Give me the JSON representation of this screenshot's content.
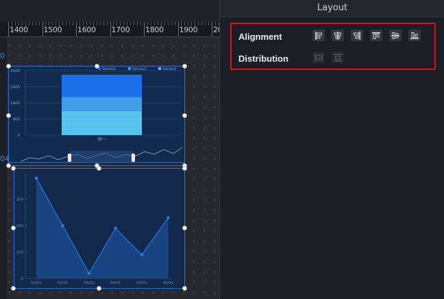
{
  "panel": {
    "title": "Layout"
  },
  "alignment": {
    "label": "Alignment",
    "tools": [
      "align-left-icon",
      "align-center-horizontal-icon",
      "align-right-icon",
      "align-top-icon",
      "align-center-vertical-icon",
      "align-bottom-icon"
    ]
  },
  "distribution": {
    "label": "Distribution",
    "tools": [
      "distribute-horizontal-icon",
      "distribute-vertical-icon"
    ]
  },
  "ruler": {
    "labels": [
      "1400",
      "1500",
      "1600",
      "1700",
      "1800",
      "1900",
      "20"
    ]
  },
  "canvas_edge_numbers": [
    "0",
    "04"
  ],
  "colors": {
    "highlight": "#e3111f",
    "selection": "#2e6fd8",
    "bar1": "#1b6fe8",
    "bar2": "#3f9ee6",
    "bar3": "#58c2ee"
  },
  "bar_chart": {
    "legend": [
      "Series1",
      "Series2",
      "Series3"
    ],
    "y_ticks": [
      "3200",
      "2400",
      "1600",
      "800",
      "0"
    ],
    "category": "周一",
    "stack": [
      1200,
      700,
      1100
    ]
  },
  "line_chart": {
    "y_ticks": [
      "300",
      "200",
      "100",
      "0"
    ],
    "x_labels": [
      "01/01",
      "02/01",
      "03/01",
      "04/01",
      "05/01",
      "06/01"
    ],
    "values": [
      380,
      200,
      20,
      190,
      90,
      230
    ]
  }
}
